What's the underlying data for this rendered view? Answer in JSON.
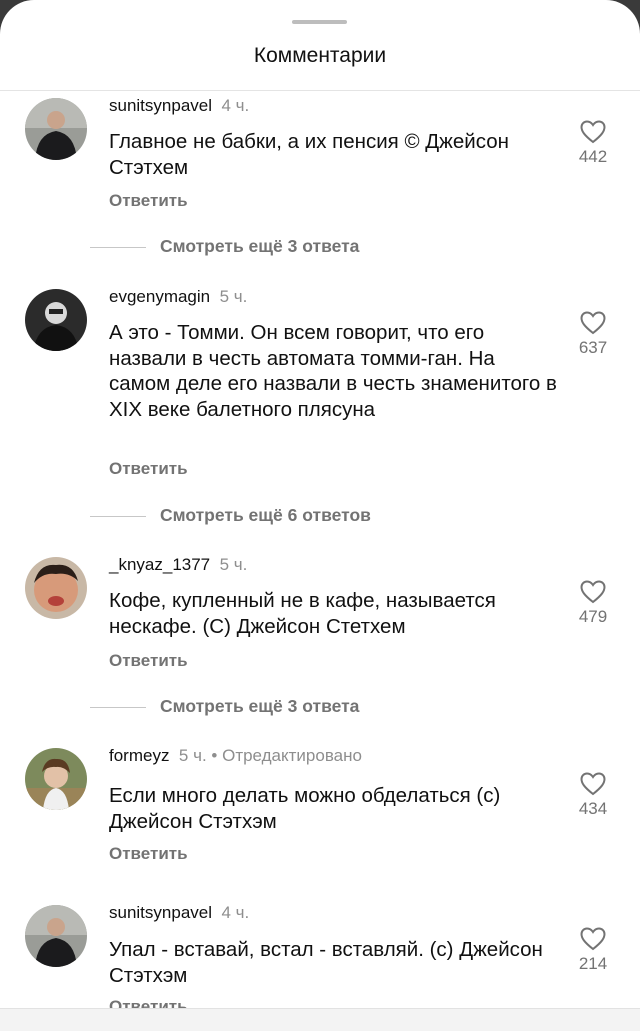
{
  "header": {
    "title": "Комментарии"
  },
  "reply_label": "Ответить",
  "comments": [
    {
      "username": "sunitsynpavel",
      "time": "4 ч.",
      "edited": "",
      "text": "Главное не бабки, а их пенсия © Джейсон Стэтхем",
      "likes": "442",
      "more_replies": "Смотреть ещё 3 ответа"
    },
    {
      "username": "evgenymagin",
      "time": "5 ч.",
      "edited": "",
      "text": "А это - Томми. Он всем говорит, что его назвали в честь автомата томми-ган. На самом деле его назвали в честь знаменитого в XIX веке балетного плясуна",
      "likes": "637",
      "more_replies": "Смотреть ещё 6 ответов"
    },
    {
      "username": "_knyaz_1377",
      "time": "5 ч.",
      "edited": "",
      "text": "Кофе, купленный не в кафе, называется нескафе. (С) Джейсон Стетхем",
      "likes": "479",
      "more_replies": "Смотреть ещё 3 ответа"
    },
    {
      "username": "formeyz",
      "time": "5 ч.",
      "edited": "• Отредактировано",
      "text": "Если много делать можно обделаться (с) Джейсон Стэтхэм",
      "likes": "434",
      "more_replies": ""
    },
    {
      "username": "sunitsynpavel",
      "time": "4 ч.",
      "edited": "",
      "text": "Упал - вставай, встал - вставляй. (с) Джейсон Стэтхэм",
      "likes": "214",
      "more_replies": ""
    }
  ]
}
